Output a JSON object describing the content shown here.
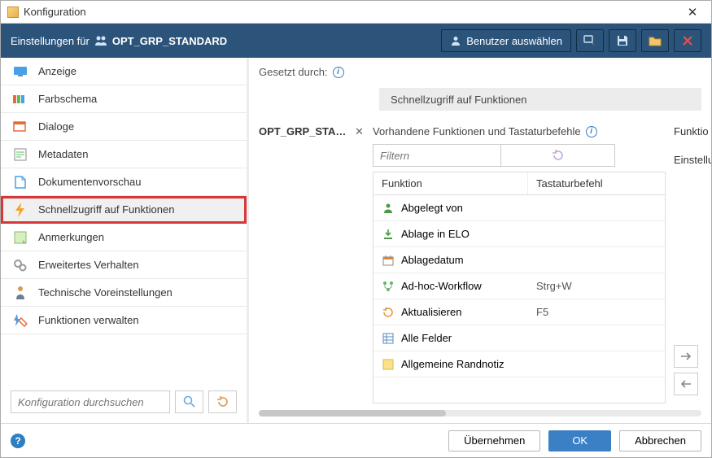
{
  "title": "Konfiguration",
  "header": {
    "prefix": "Einstellungen für",
    "target": "OPT_GRP_STANDARD",
    "select_user": "Benutzer auswählen"
  },
  "sidebar": {
    "items": [
      {
        "label": "Anzeige"
      },
      {
        "label": "Farbschema"
      },
      {
        "label": "Dialoge"
      },
      {
        "label": "Metadaten"
      },
      {
        "label": "Dokumentenvorschau"
      },
      {
        "label": "Schnellzugriff auf Funktionen"
      },
      {
        "label": "Anmerkungen"
      },
      {
        "label": "Erweitertes Verhalten"
      },
      {
        "label": "Technische Voreinstellungen"
      },
      {
        "label": "Funktionen verwalten"
      }
    ],
    "search_placeholder": "Konfiguration durchsuchen"
  },
  "main": {
    "set_by_label": "Gesetzt durch:",
    "panel_title": "Schnellzugriff auf Funktionen",
    "chip": "OPT_GRP_STAN...",
    "available_label": "Vorhandene Funktionen und Tastaturbefehle",
    "right_label_1": "Funktio",
    "right_label_2": "Einstellu",
    "filter_placeholder": "Filtern",
    "col_function": "Funktion",
    "col_shortcut": "Tastaturbefehl",
    "rows": [
      {
        "label": "Abgelegt von",
        "shortcut": ""
      },
      {
        "label": "Ablage in ELO",
        "shortcut": ""
      },
      {
        "label": "Ablagedatum",
        "shortcut": ""
      },
      {
        "label": "Ad-hoc-Workflow",
        "shortcut": "Strg+W"
      },
      {
        "label": "Aktualisieren",
        "shortcut": "F5"
      },
      {
        "label": "Alle Felder",
        "shortcut": ""
      },
      {
        "label": "Allgemeine Randnotiz",
        "shortcut": ""
      }
    ]
  },
  "footer": {
    "apply": "Übernehmen",
    "ok": "OK",
    "cancel": "Abbrechen"
  }
}
